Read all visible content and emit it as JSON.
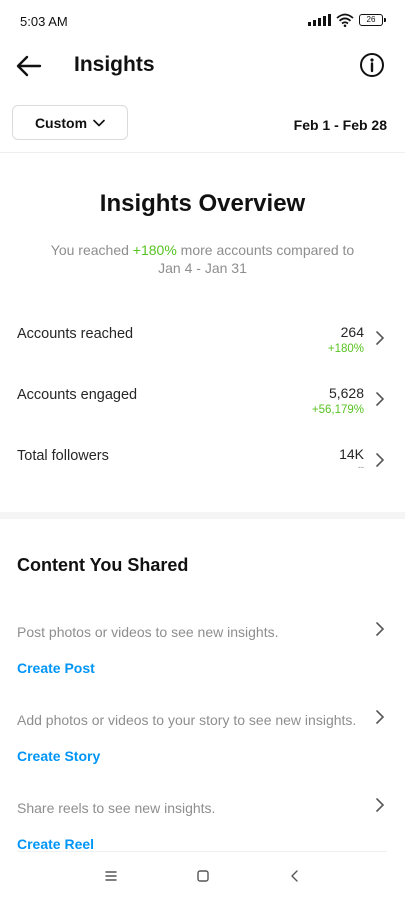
{
  "status_bar": {
    "time": "5:03 AM",
    "battery": "26",
    "icons": [
      "signal-icon",
      "wifi-icon",
      "battery-icon"
    ]
  },
  "header": {
    "title": "Insights",
    "back_icon": "arrow-left-icon",
    "info_icon": "info-icon"
  },
  "filter": {
    "period_label": "Custom",
    "date_range": "Feb 1 - Feb 28"
  },
  "overview": {
    "title": "Insights Overview",
    "subtitle_prefix": "You reached ",
    "subtitle_highlight": "+180%",
    "subtitle_suffix": " more accounts compared to",
    "subtitle_line2": "Jan 4 - Jan 31",
    "metrics": [
      {
        "label": "Accounts reached",
        "value": "264",
        "change": "+180%"
      },
      {
        "label": "Accounts engaged",
        "value": "5,628",
        "change": "+56,179%"
      },
      {
        "label": "Total followers",
        "value": "14K",
        "change": "--"
      }
    ]
  },
  "content_shared": {
    "title": "Content You Shared",
    "items": [
      {
        "text": "Post photos or videos to see new insights.",
        "action": "Create Post"
      },
      {
        "text": "Add photos or videos to your story to see new insights.",
        "action": "Create Story"
      },
      {
        "text": "Share reels to see new insights.",
        "action": "Create Reel"
      }
    ]
  },
  "colors": {
    "positive": "#58c322",
    "link": "#0095f6",
    "muted": "#8e8e8e"
  },
  "nav": {
    "icons": [
      "menu-icon",
      "home-square-icon",
      "back-triangle-icon"
    ]
  }
}
